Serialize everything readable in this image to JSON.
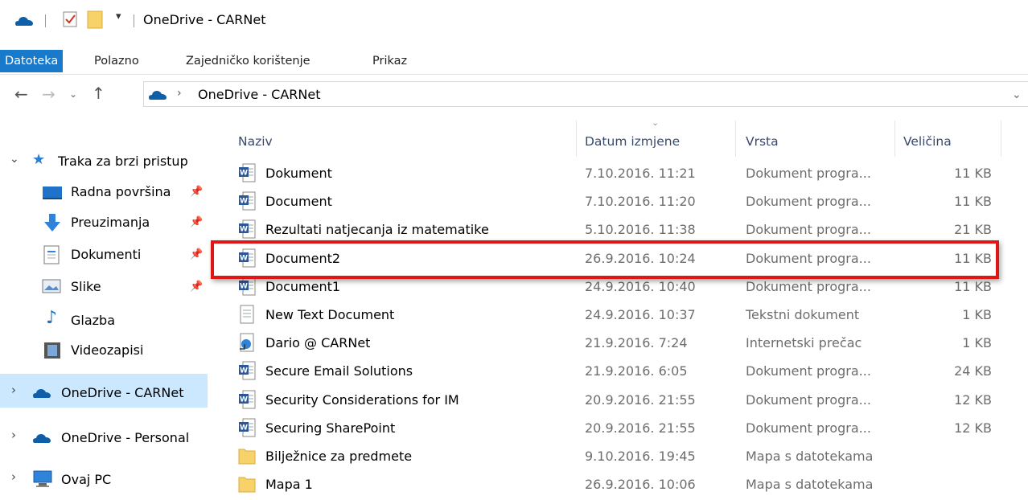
{
  "window": {
    "title": "OneDrive - CARNet"
  },
  "ribbon": {
    "tabs": [
      "Datoteka",
      "Polazno",
      "Zajedničko korištenje",
      "Prikaz"
    ]
  },
  "address": {
    "path": [
      "OneDrive - CARNet"
    ]
  },
  "sidebar": {
    "quick_access": "Traka za brzi pristup",
    "items": [
      {
        "label": "Radna površina",
        "icon": "desktop-icon",
        "pinned": true
      },
      {
        "label": "Preuzimanja",
        "icon": "download-icon",
        "pinned": true
      },
      {
        "label": "Dokumenti",
        "icon": "documents-icon",
        "pinned": true
      },
      {
        "label": "Slike",
        "icon": "pictures-icon",
        "pinned": true
      },
      {
        "label": "Glazba",
        "icon": "music-icon",
        "pinned": false
      },
      {
        "label": "Videozapisi",
        "icon": "video-icon",
        "pinned": false
      }
    ],
    "roots": [
      {
        "label": "OneDrive - CARNet",
        "icon": "onedrive-icon",
        "selected": true
      },
      {
        "label": "OneDrive - Personal",
        "icon": "onedrive-icon",
        "selected": false
      },
      {
        "label": "Ovaj PC",
        "icon": "pc-icon",
        "selected": false
      }
    ]
  },
  "columns": {
    "name": "Naziv",
    "date": "Datum izmjene",
    "type": "Vrsta",
    "size": "Veličina"
  },
  "files": [
    {
      "name": "Dokument",
      "date": "7.10.2016. 11:21",
      "type": "Dokument progra...",
      "size": "11 KB",
      "icon": "word-icon"
    },
    {
      "name": "Document",
      "date": "7.10.2016. 11:20",
      "type": "Dokument progra...",
      "size": "11 KB",
      "icon": "word-icon"
    },
    {
      "name": "Rezultati natjecanja iz matematike",
      "date": "5.10.2016. 11:38",
      "type": "Dokument progra...",
      "size": "21 KB",
      "icon": "word-icon"
    },
    {
      "name": "Document2",
      "date": "26.9.2016. 10:24",
      "type": "Dokument progra...",
      "size": "11 KB",
      "icon": "word-icon"
    },
    {
      "name": "Document1",
      "date": "24.9.2016. 10:40",
      "type": "Dokument progra...",
      "size": "11 KB",
      "icon": "word-icon"
    },
    {
      "name": "New Text Document",
      "date": "24.9.2016. 10:37",
      "type": "Tekstni dokument",
      "size": "1 KB",
      "icon": "text-file-icon"
    },
    {
      "name": "Dario @ CARNet",
      "date": "21.9.2016. 7:24",
      "type": "Internetski prečac",
      "size": "1 KB",
      "icon": "internet-shortcut-icon"
    },
    {
      "name": "Secure Email Solutions",
      "date": "21.9.2016. 6:05",
      "type": "Dokument progra...",
      "size": "24 KB",
      "icon": "word-icon"
    },
    {
      "name": "Security Considerations for IM",
      "date": "20.9.2016. 21:55",
      "type": "Dokument progra...",
      "size": "12 KB",
      "icon": "word-icon"
    },
    {
      "name": "Securing SharePoint",
      "date": "20.9.2016. 21:55",
      "type": "Dokument progra...",
      "size": "12 KB",
      "icon": "word-icon"
    },
    {
      "name": "Bilježnice za predmete",
      "date": "9.10.2016. 19:45",
      "type": "Mapa s datotekama",
      "size": "",
      "icon": "folder-icon"
    },
    {
      "name": "Mapa 1",
      "date": "26.9.2016. 10:06",
      "type": "Mapa s datotekama",
      "size": "",
      "icon": "folder-icon"
    }
  ],
  "colors": {
    "accent": "#1979ca",
    "selected_bg": "#cce8ff",
    "highlight_border": "#e01515",
    "onedrive_blue": "#0f5fa8"
  }
}
